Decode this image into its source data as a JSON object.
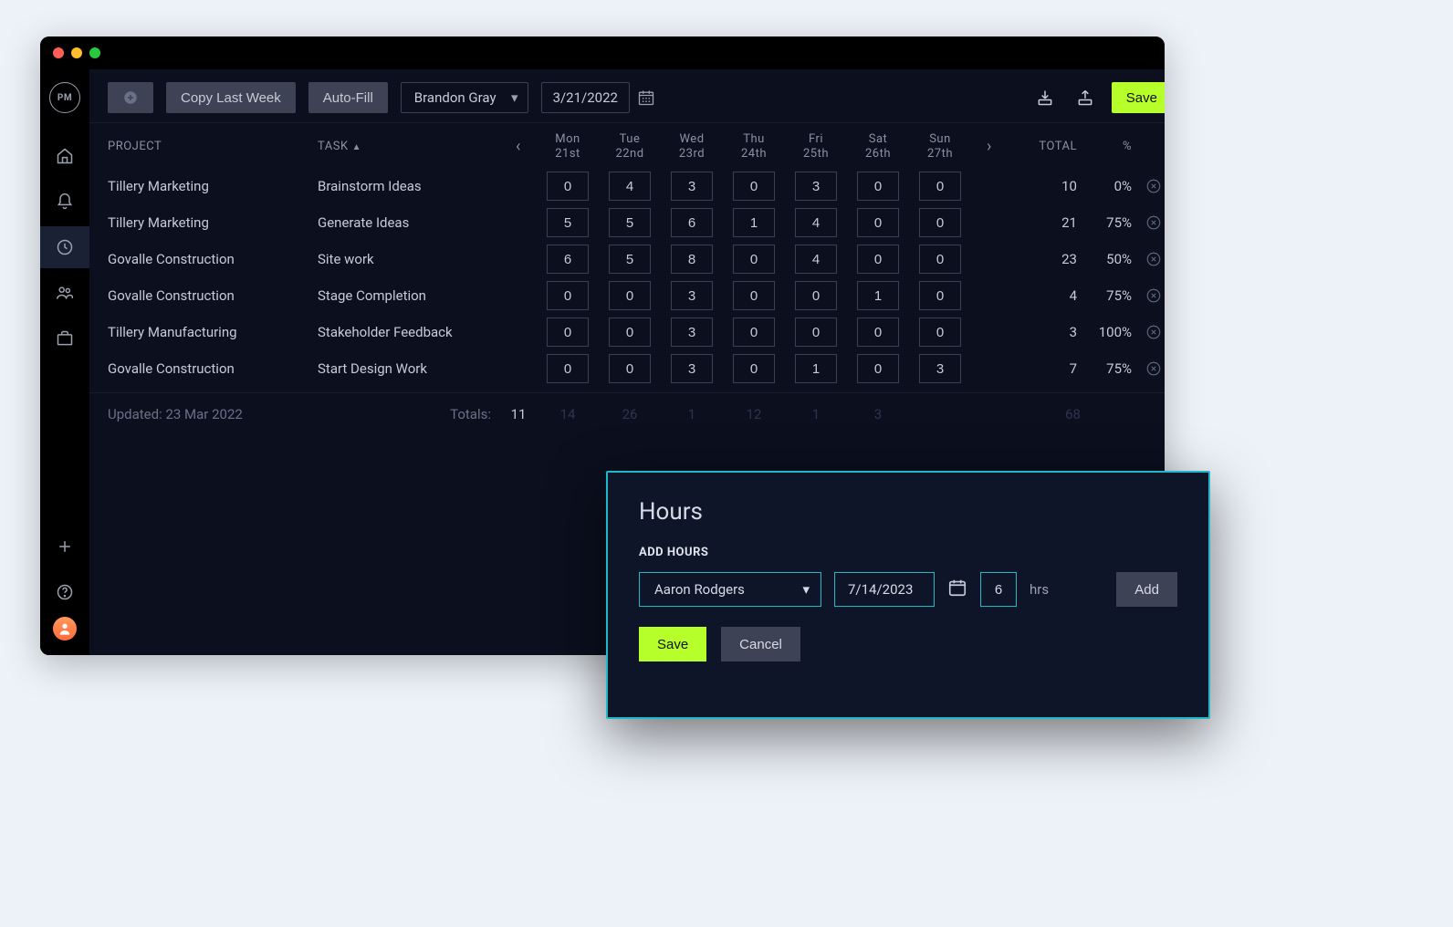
{
  "toolbar": {
    "copy_label": "Copy Last Week",
    "autofill_label": "Auto-Fill",
    "user_selected": "Brandon Gray",
    "date_selected": "3/21/2022",
    "save_label": "Save"
  },
  "headers": {
    "project": "PROJECT",
    "task": "TASK",
    "total": "TOTAL",
    "percent": "%",
    "days": [
      {
        "d": "Mon",
        "n": "21st"
      },
      {
        "d": "Tue",
        "n": "22nd"
      },
      {
        "d": "Wed",
        "n": "23rd"
      },
      {
        "d": "Thu",
        "n": "24th"
      },
      {
        "d": "Fri",
        "n": "25th"
      },
      {
        "d": "Sat",
        "n": "26th"
      },
      {
        "d": "Sun",
        "n": "27th"
      }
    ]
  },
  "rows": [
    {
      "project": "Tillery Marketing",
      "task": "Brainstorm Ideas",
      "hours": [
        "0",
        "4",
        "3",
        "0",
        "3",
        "0",
        "0"
      ],
      "total": "10",
      "pct": "0%"
    },
    {
      "project": "Tillery Marketing",
      "task": "Generate Ideas",
      "hours": [
        "5",
        "5",
        "6",
        "1",
        "4",
        "0",
        "0"
      ],
      "total": "21",
      "pct": "75%"
    },
    {
      "project": "Govalle Construction",
      "task": "Site work",
      "hours": [
        "6",
        "5",
        "8",
        "0",
        "4",
        "0",
        "0"
      ],
      "total": "23",
      "pct": "50%"
    },
    {
      "project": "Govalle Construction",
      "task": "Stage Completion",
      "hours": [
        "0",
        "0",
        "3",
        "0",
        "0",
        "1",
        "0"
      ],
      "total": "4",
      "pct": "75%"
    },
    {
      "project": "Tillery Manufacturing",
      "task": "Stakeholder Feedback",
      "hours": [
        "0",
        "0",
        "3",
        "0",
        "0",
        "0",
        "0"
      ],
      "total": "3",
      "pct": "100%"
    },
    {
      "project": "Govalle Construction",
      "task": "Start Design Work",
      "hours": [
        "0",
        "0",
        "3",
        "0",
        "1",
        "0",
        "3"
      ],
      "total": "7",
      "pct": "75%"
    }
  ],
  "footer": {
    "updated_label": "Updated: 23 Mar 2022",
    "totals_label": "Totals:",
    "totals": [
      "11",
      "14",
      "26",
      "1",
      "12",
      "1",
      "3"
    ],
    "grand_total": "68"
  },
  "modal": {
    "title": "Hours",
    "subtitle": "ADD HOURS",
    "user": "Aaron Rodgers",
    "date": "7/14/2023",
    "hours": "6",
    "hrs_label": "hrs",
    "add_label": "Add",
    "save_label": "Save",
    "cancel_label": "Cancel"
  }
}
